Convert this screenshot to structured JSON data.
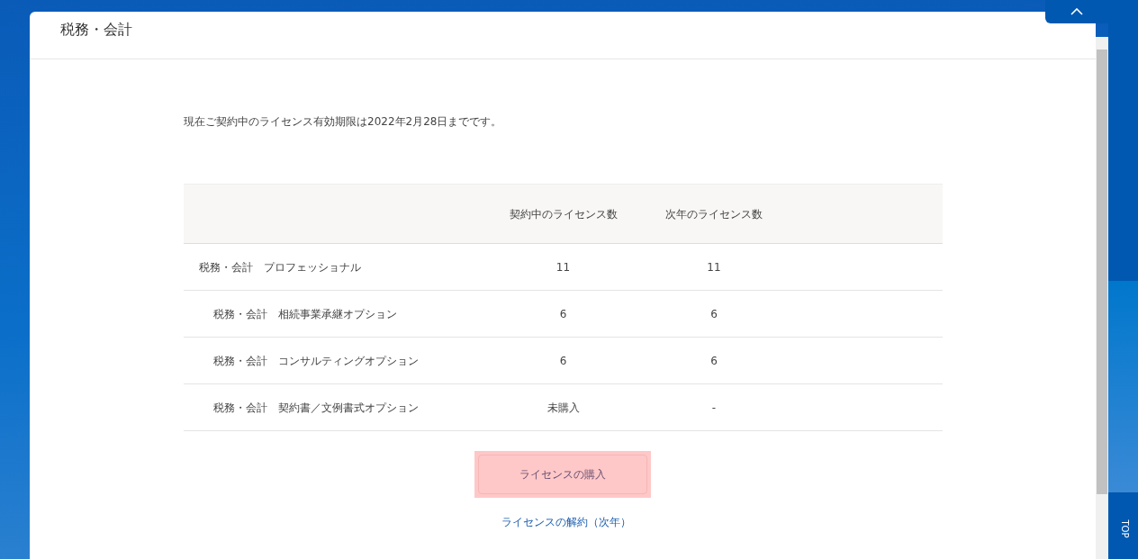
{
  "page_title": "税務・会計",
  "notice": "現在ご契約中のライセンス有効期限は2022年2月28日までです。",
  "table": {
    "columns": [
      "契約中のライセンス数",
      "次年のライセンス数"
    ],
    "rows": [
      {
        "name": "税務・会計　プロフェッショナル",
        "current": "11",
        "next": "11",
        "children": [
          {
            "name": "税務・会計　相続事業承継オプション",
            "current": "6",
            "next": "6"
          },
          {
            "name": "税務・会計　コンサルティングオプション",
            "current": "6",
            "next": "6"
          },
          {
            "name": "税務・会計　契約書／文例書式オプション",
            "current": "未購入",
            "next": "-"
          }
        ]
      }
    ]
  },
  "purchase_button": "ライセンスの購入",
  "cancel_link": "ライセンスの解約（次年）",
  "side_tab": "TOP"
}
